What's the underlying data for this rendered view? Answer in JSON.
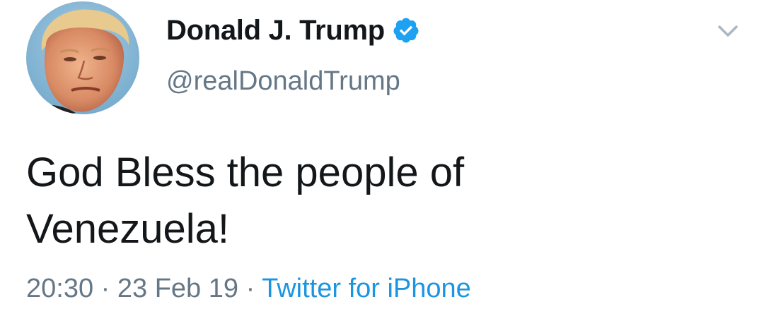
{
  "tweet": {
    "display_name": "Donald J. Trump",
    "handle": "@realDonaldTrump",
    "verified": true,
    "text_line1": "God Bless the people of",
    "text_line2": "Venezuela!",
    "time": "20:30",
    "date": "23 Feb 19",
    "separator": "·",
    "source": "Twitter for iPhone"
  },
  "icons": {
    "verified": "verified-badge-icon",
    "more": "chevron-down-icon"
  },
  "colors": {
    "text": "#14171a",
    "secondary": "#657786",
    "link": "#1b95e0",
    "verified": "#1da1f2",
    "chevron": "#aab8c2"
  }
}
